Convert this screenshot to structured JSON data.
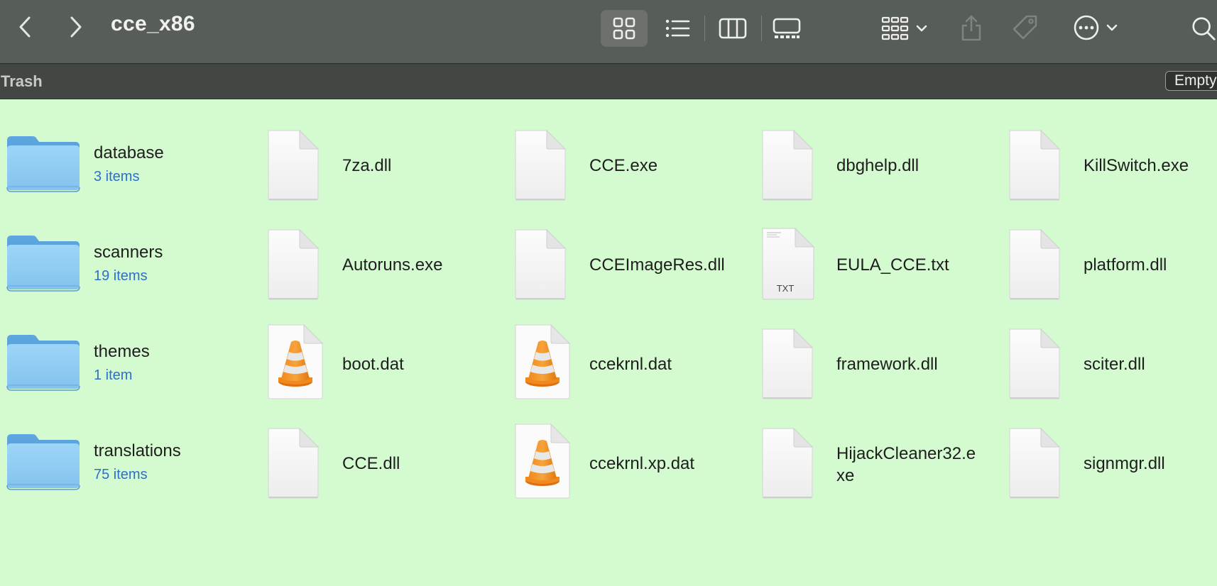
{
  "toolbar": {
    "title": "cce_x86"
  },
  "trash": {
    "label": "Trash",
    "empty_button": "Empty"
  },
  "folders": [
    {
      "name": "database",
      "count": "3 items"
    },
    {
      "name": "scanners",
      "count": "19 items"
    },
    {
      "name": "themes",
      "count": "1 item"
    },
    {
      "name": "translations",
      "count": "75 items"
    }
  ],
  "files": [
    {
      "name": "7za.dll",
      "icon": "generic-document-icon"
    },
    {
      "name": "Autoruns.exe",
      "icon": "generic-document-icon"
    },
    {
      "name": "boot.dat",
      "icon": "vlc-cone-icon"
    },
    {
      "name": "CCE.dll",
      "icon": "generic-document-icon"
    },
    {
      "name": "CCE.exe",
      "icon": "generic-document-icon"
    },
    {
      "name": "CCEImageRes.dll",
      "icon": "generic-document-icon"
    },
    {
      "name": "ccekrnl.dat",
      "icon": "vlc-cone-icon"
    },
    {
      "name": "ccekrnl.xp.dat",
      "icon": "vlc-cone-icon"
    },
    {
      "name": "dbghelp.dll",
      "icon": "generic-document-icon"
    },
    {
      "name": "EULA_CCE.txt",
      "icon": "text-document-icon",
      "badge": "TXT"
    },
    {
      "name": "framework.dll",
      "icon": "generic-document-icon"
    },
    {
      "name": "HijackCleaner32.exe",
      "icon": "generic-document-icon"
    },
    {
      "name": "KillSwitch.exe",
      "icon": "generic-document-icon"
    },
    {
      "name": "platform.dll",
      "icon": "generic-document-icon"
    },
    {
      "name": "sciter.dll",
      "icon": "generic-document-icon"
    },
    {
      "name": "signmgr.dll",
      "icon": "generic-document-icon"
    }
  ],
  "colors": {
    "content_bg": "#d4fad0",
    "toolbar_bg": "#575d57",
    "trashbar_bg": "#434743",
    "folder_blue": "#8ccaf3",
    "item_count_blue": "#2e6fc9"
  }
}
